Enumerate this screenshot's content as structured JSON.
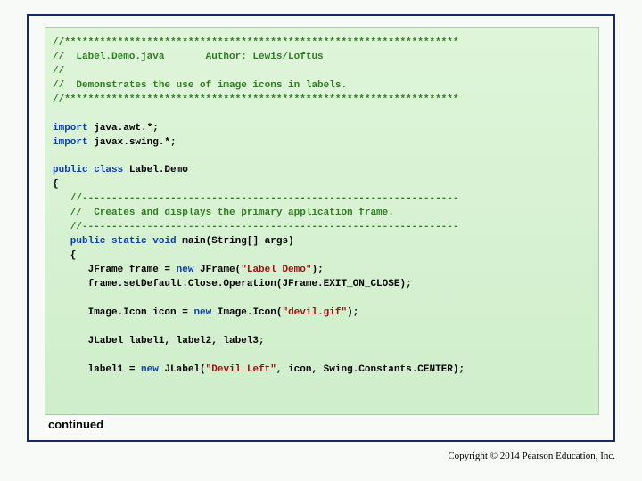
{
  "code": {
    "l1": "//*******************************************************************",
    "l2_a": "//  Label.Demo.java       Author: Lewis/Loftus",
    "l3": "//",
    "l4": "//  Demonstrates the use of image icons in labels.",
    "l5": "//*******************************************************************",
    "imp1a": "import",
    "imp1b": " java.awt.*;",
    "imp2a": "import",
    "imp2b": " javax.swing.*;",
    "cls1a": "public",
    "cls1b": " class",
    "cls1c": " Label.Demo",
    "brace_open": "{",
    "c1": "   //----------------------------------------------------------------",
    "c2": "   //  Creates and displays the primary application frame.",
    "c3": "   //----------------------------------------------------------------",
    "m1a": "   public",
    "m1b": " static",
    "m1c": " void",
    "m1d": " main(String[] args)",
    "m_open": "   {",
    "f1a": "      JFrame frame = ",
    "f1b": "new",
    "f1c": " JFrame(",
    "f1d": "\"Label Demo\"",
    "f1e": ");",
    "f2a": "      frame.setDefault.Close.Operation(JFrame.EXIT_ON_CLOSE);",
    "i1a": "      Image.Icon icon = ",
    "i1b": "new",
    "i1c": " Image.Icon(",
    "i1d": "\"devil.gif\"",
    "i1e": ");",
    "lbl_decl": "      JLabel label1, label2, label3;",
    "l1a": "      label1 = ",
    "l1b": "new",
    "l1c": " JLabel(",
    "l1d": "\"Devil Left\"",
    "l1e": ", icon, Swing.Constants.CENTER);"
  },
  "continued": "continued",
  "copyright": "Copyright © 2014 Pearson Education, Inc."
}
